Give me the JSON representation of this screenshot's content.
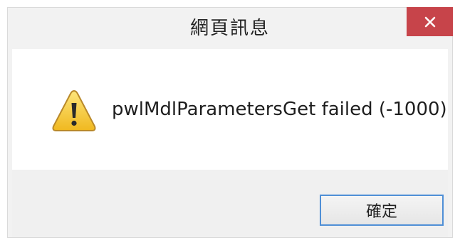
{
  "window": {
    "title": "網頁訊息",
    "close_icon": "close-icon"
  },
  "message": {
    "icon": "warning-icon",
    "text": "pwlMdlParametersGet failed (-1000)"
  },
  "buttons": {
    "ok_label": "確定"
  },
  "colors": {
    "close_button": "#c7444a",
    "ok_border": "#4f8fd6",
    "warning_fill": "#f4c430"
  }
}
